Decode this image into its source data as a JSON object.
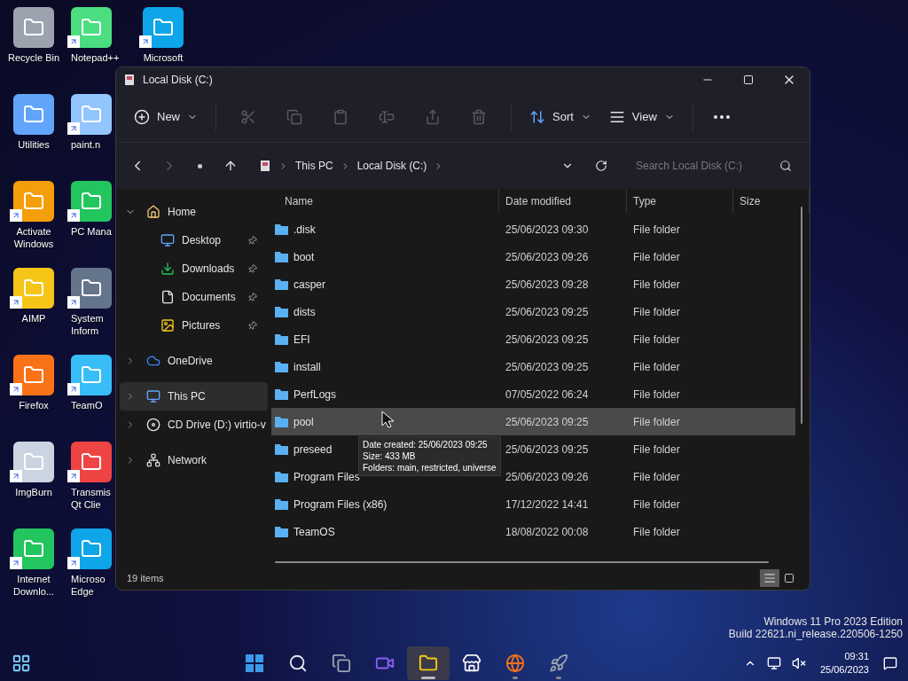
{
  "desktop": {
    "columns": [
      [
        {
          "label": "Recycle Bin",
          "shortcut": false
        },
        {
          "label": "Utilities",
          "shortcut": false
        },
        {
          "label": "Activate Windows",
          "shortcut": true
        },
        {
          "label": "AIMP",
          "shortcut": true
        },
        {
          "label": "Firefox",
          "shortcut": true
        },
        {
          "label": "ImgBurn",
          "shortcut": true
        },
        {
          "label": "Internet Downlo...",
          "shortcut": true
        }
      ],
      [
        {
          "label": "Notepad++",
          "shortcut": true
        },
        {
          "label": "paint.n",
          "shortcut": true
        },
        {
          "label": "PC Mana",
          "shortcut": true
        },
        {
          "label": "System Inform",
          "shortcut": true
        },
        {
          "label": "TeamO",
          "shortcut": true
        },
        {
          "label": "Transmis Qt Clie",
          "shortcut": true
        },
        {
          "label": "Microso Edge",
          "shortcut": true
        }
      ],
      [
        {
          "label": "Microsoft",
          "shortcut": true
        }
      ]
    ]
  },
  "window": {
    "title": "Local Disk (C:)"
  },
  "toolbar": [
    {
      "kind": "labeled",
      "label": "New",
      "disabled": false
    },
    {
      "kind": "icon",
      "disabled": true
    },
    {
      "kind": "icon",
      "disabled": true
    },
    {
      "kind": "icon",
      "disabled": true
    },
    {
      "kind": "icon",
      "disabled": true
    },
    {
      "kind": "icon",
      "disabled": true
    },
    {
      "kind": "icon",
      "disabled": true
    },
    {
      "kind": "labeled",
      "label": "Sort",
      "disabled": false
    },
    {
      "kind": "labeled",
      "label": "View",
      "disabled": false
    },
    {
      "kind": "more",
      "disabled": false
    }
  ],
  "address": {
    "back_disabled": false,
    "forward_disabled": true,
    "breadcrumbs": [
      "This PC",
      "Local Disk (C:)"
    ],
    "search": {
      "placeholder": "Search Local Disk (C:)"
    }
  },
  "sidebar": {
    "items": [
      {
        "label": "Home",
        "expanded": true,
        "selected": false,
        "children": [
          {
            "label": "Desktop",
            "pinned": true,
            "selected": false
          },
          {
            "label": "Downloads",
            "pinned": true,
            "selected": false
          },
          {
            "label": "Documents",
            "pinned": true,
            "selected": false
          },
          {
            "label": "Pictures",
            "pinned": true,
            "selected": false
          }
        ]
      },
      {
        "label": "OneDrive",
        "expanded": false,
        "selected": false
      },
      {
        "label": "This PC",
        "expanded": false,
        "selected": true
      },
      {
        "label": "CD Drive (D:) virtio-v",
        "expanded": false,
        "selected": false
      },
      {
        "label": "Network",
        "expanded": false,
        "selected": false
      }
    ]
  },
  "table": {
    "columns": [
      "Name",
      "Date modified",
      "Type",
      "Size"
    ],
    "rows": [
      {
        "name": ".disk",
        "date": "25/06/2023 09:30",
        "type": "File folder",
        "selected": false
      },
      {
        "name": "boot",
        "date": "25/06/2023 09:26",
        "type": "File folder",
        "selected": false
      },
      {
        "name": "casper",
        "date": "25/06/2023 09:28",
        "type": "File folder",
        "selected": false
      },
      {
        "name": "dists",
        "date": "25/06/2023 09:25",
        "type": "File folder",
        "selected": false
      },
      {
        "name": "EFI",
        "date": "25/06/2023 09:25",
        "type": "File folder",
        "selected": false
      },
      {
        "name": "install",
        "date": "25/06/2023 09:25",
        "type": "File folder",
        "selected": false
      },
      {
        "name": "PerfLogs",
        "date": "07/05/2022 06:24",
        "type": "File folder",
        "selected": false
      },
      {
        "name": "pool",
        "date": "25/06/2023 09:25",
        "type": "File folder",
        "selected": true
      },
      {
        "name": "preseed",
        "date": "25/06/2023 09:25",
        "type": "File folder",
        "selected": false
      },
      {
        "name": "Program Files",
        "date": "25/06/2023 09:26",
        "type": "File folder",
        "selected": false
      },
      {
        "name": "Program Files (x86)",
        "date": "17/12/2022 14:41",
        "type": "File folder",
        "selected": false
      },
      {
        "name": "TeamOS",
        "date": "18/08/2022 00:08",
        "type": "File folder",
        "selected": false
      }
    ]
  },
  "tooltip": [
    "Date created: 25/06/2023 09:25",
    "Size: 433 MB",
    "Folders: main, restricted, universe"
  ],
  "status_bar": {
    "count": "19 items",
    "views": [
      {
        "selected": true
      },
      {
        "selected": false
      }
    ]
  },
  "watermark": [
    "Windows 11 Pro 2023 Edition",
    "Build 22621.ni_release.220506-1250"
  ],
  "taskbar": {
    "apps": [
      {
        "selected": false,
        "running": false
      },
      {
        "selected": false,
        "running": false
      },
      {
        "selected": false,
        "running": false
      },
      {
        "selected": true,
        "running": true
      },
      {
        "selected": false,
        "running": false
      },
      {
        "selected": false,
        "running": true
      },
      {
        "selected": false,
        "running": true
      }
    ],
    "time": "09:31",
    "date": "25/06/2023"
  }
}
